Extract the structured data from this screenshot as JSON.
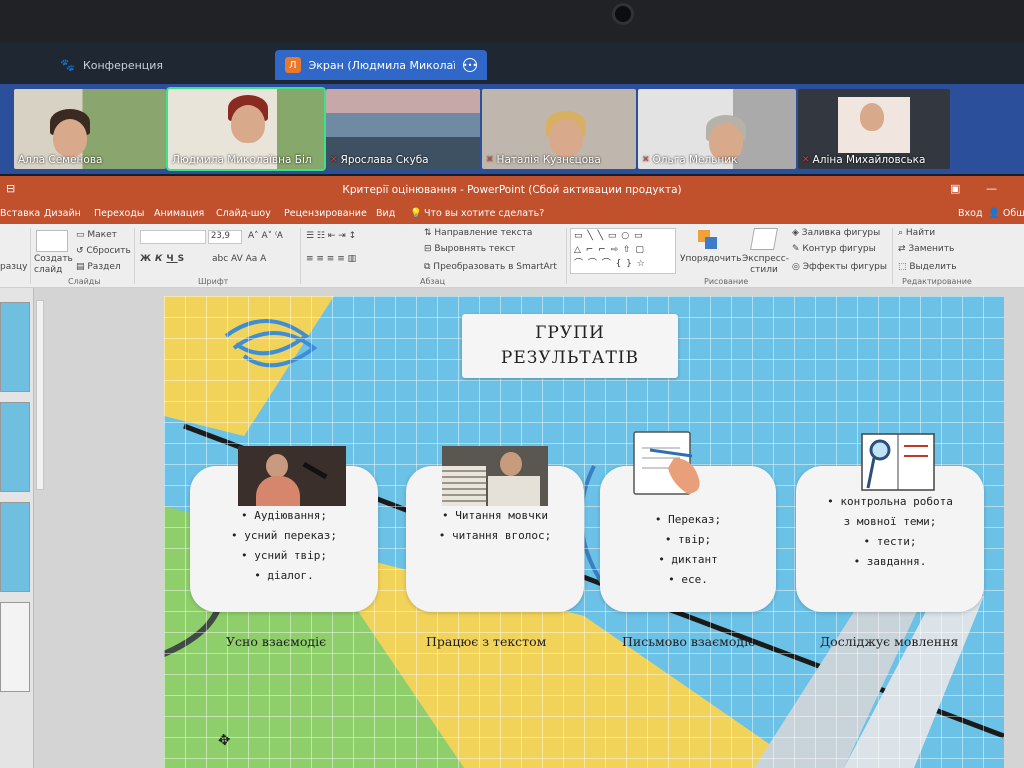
{
  "conference": {
    "tabs": [
      {
        "label": "Конференция"
      },
      {
        "badge": "Л",
        "label": "Экран (Людмила Миколаївна Біл"
      }
    ],
    "participants": [
      {
        "name": "Алла Семенова",
        "muted": false
      },
      {
        "name": "Людмила Миколаївна Біл",
        "muted": false
      },
      {
        "name": "Ярослава Скуба",
        "muted": true
      },
      {
        "name": "Наталія Кузнєцова",
        "muted": true
      },
      {
        "name": "Ольга Мельник",
        "muted": true
      },
      {
        "name": "Аліна Михайловська",
        "muted": true
      }
    ]
  },
  "powerpoint": {
    "window_title": "Критерії оцінювання - PowerPoint (Сбой активации продукта)",
    "tabs": [
      "Вставка",
      "Дизайн",
      "Переходы",
      "Анимация",
      "Слайд-шоу",
      "Рецензирование",
      "Вид"
    ],
    "tell_me": "Что вы хотите сделать?",
    "signin": "Вход",
    "share": "Общ",
    "ribbon": {
      "paste_label": "разцу",
      "create_slide": "Создать слайд",
      "layout": "Макет",
      "reset": "Сбросить",
      "section": "Раздел",
      "slides_group": "Слайды",
      "font_size": "23,9",
      "font_group": "Шрифт",
      "text_direction": "Направление текста",
      "align_text": "Выровнять текст",
      "smartart": "Преобразовать в SmartArt",
      "paragraph_group": "Абзац",
      "arrange": "Упорядочить",
      "quick_styles": "Экспресс-стили",
      "shape_fill": "Заливка фигуры",
      "shape_outline": "Контур фигуры",
      "shape_effects": "Эффекты фигуры",
      "drawing_group": "Рисование",
      "find": "Найти",
      "replace": "Заменить",
      "select": "Выделить",
      "editing_group": "Редактирование",
      "bold": "Ж",
      "italic": "К",
      "underline": "Ч",
      "strike": "S",
      "abc": "abc"
    },
    "slide": {
      "title_line1": "ГРУПИ",
      "title_line2": "РЕЗУЛЬТАТІВ",
      "cards": [
        {
          "items": [
            "• Аудіювання;",
            "• усний переказ;",
            "• усний твір;",
            "• діалог."
          ],
          "caption": "Усно взаємодіє"
        },
        {
          "items": [
            "• Читання мовчки",
            "• читання вголос;"
          ],
          "caption": "Працює з текстом"
        },
        {
          "items": [
            "• Переказ;",
            "• твір;",
            "• диктант",
            "• есе."
          ],
          "caption": "Письмово взаємодіє"
        },
        {
          "items": [
            "• контрольна робота",
            "з мовної теми;",
            "• тести;",
            "• завдання."
          ],
          "caption": "Досліджує мовлення"
        }
      ]
    }
  },
  "colors": {
    "ppt_orange": "#c1502d",
    "zoom_blue": "#2b4f9a",
    "slide_blue": "#6cc2e6",
    "slide_yellow": "#f2d35a",
    "slide_green": "#8fcf6b"
  }
}
